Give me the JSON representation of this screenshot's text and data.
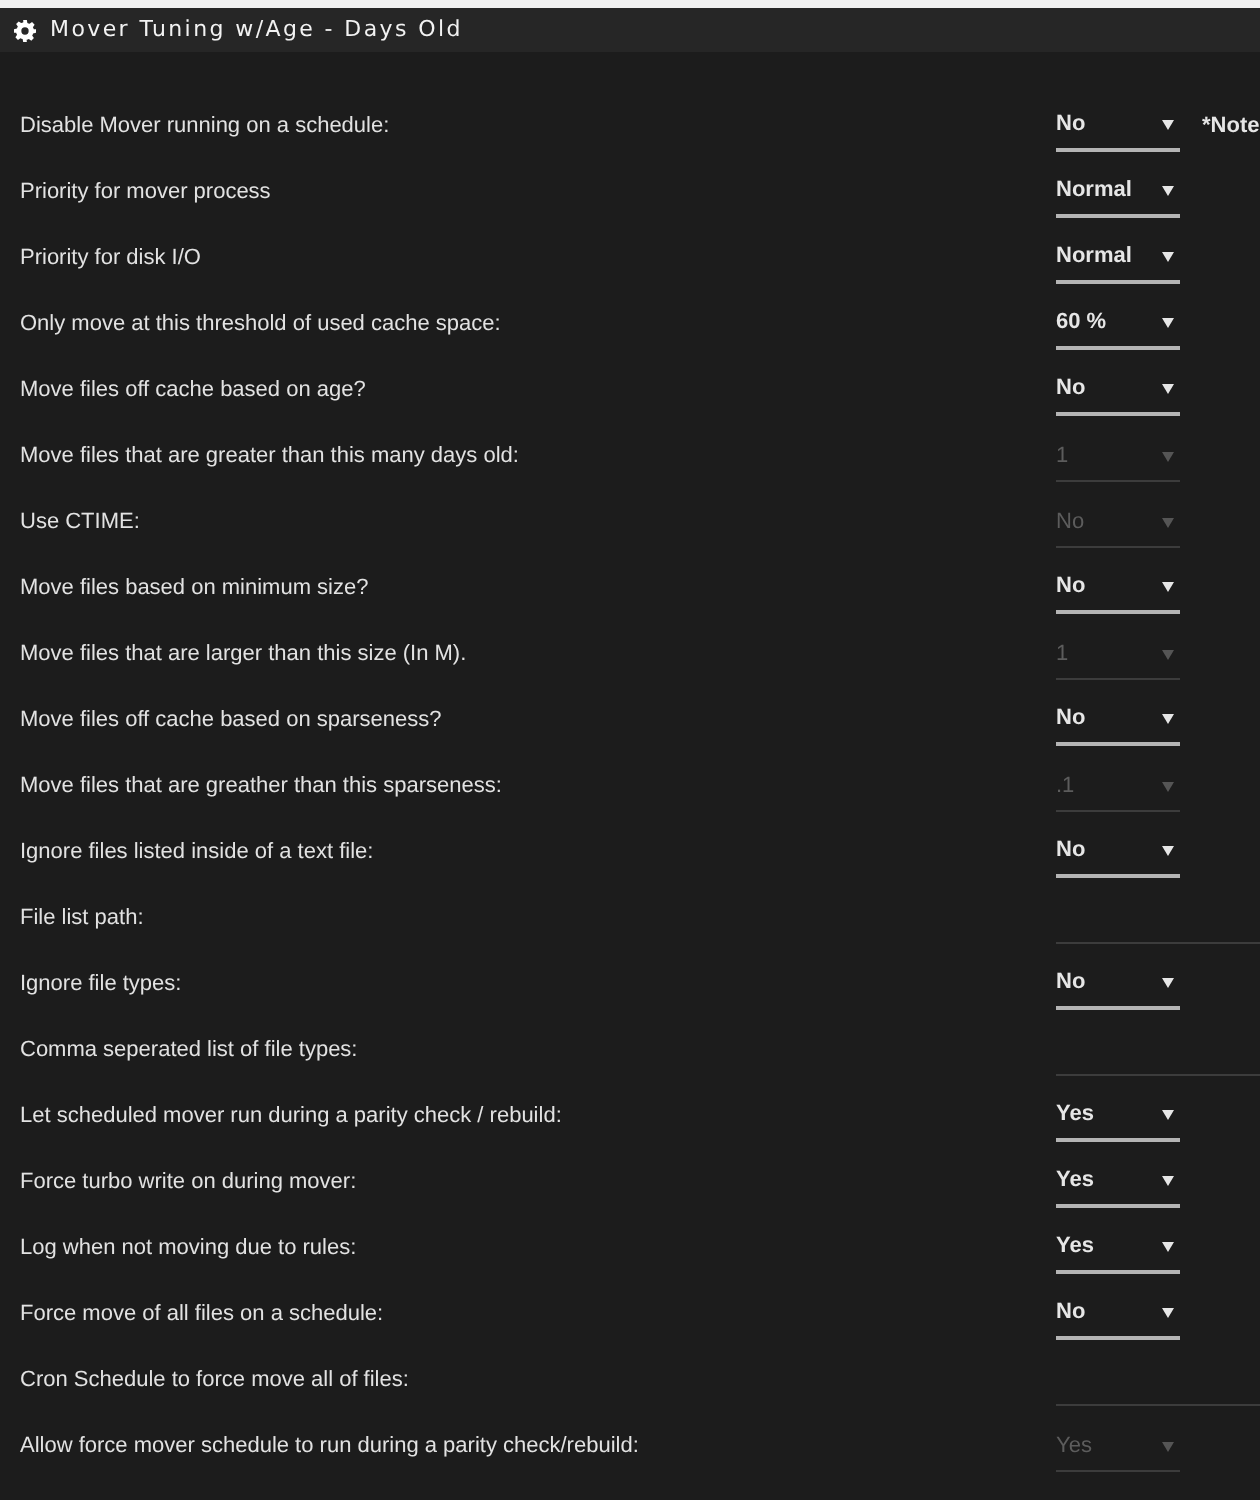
{
  "window": {
    "title": "Mover Tuning w/Age - Days Old"
  },
  "settings": [
    {
      "label": "Disable Mover running on a schedule:",
      "kind": "dropdown",
      "value": "No",
      "disabled": false,
      "note": "*Note"
    },
    {
      "label": "Priority for mover process",
      "kind": "dropdown",
      "value": "Normal",
      "disabled": false
    },
    {
      "label": "Priority for disk I/O",
      "kind": "dropdown",
      "value": "Normal",
      "disabled": false
    },
    {
      "label": "Only move at this threshold of used cache space:",
      "kind": "dropdown",
      "value": "60 %",
      "disabled": false
    },
    {
      "label": "Move files off cache based on age?",
      "kind": "dropdown",
      "value": "No",
      "disabled": false
    },
    {
      "label": "Move files that are greater than this many days old:",
      "kind": "dropdown",
      "value": "1",
      "disabled": true
    },
    {
      "label": "Use CTIME:",
      "kind": "dropdown",
      "value": "No",
      "disabled": true
    },
    {
      "label": "Move files based on minimum size?",
      "kind": "dropdown",
      "value": "No",
      "disabled": false
    },
    {
      "label": "Move files that are larger than this size (In M).",
      "kind": "dropdown",
      "value": "1",
      "disabled": true
    },
    {
      "label": "Move files off cache based on sparseness?",
      "kind": "dropdown",
      "value": "No",
      "disabled": false
    },
    {
      "label": "Move files that are greather than this sparseness:",
      "kind": "dropdown",
      "value": ".1",
      "disabled": true
    },
    {
      "label": "Ignore files listed inside of a text file:",
      "kind": "dropdown",
      "value": "No",
      "disabled": false
    },
    {
      "label": "File list path:",
      "kind": "text"
    },
    {
      "label": "Ignore file types:",
      "kind": "dropdown",
      "value": "No",
      "disabled": false
    },
    {
      "label": "Comma seperated list of file types:",
      "kind": "text"
    },
    {
      "label": "Let scheduled mover run during a parity check / rebuild:",
      "kind": "dropdown",
      "value": "Yes",
      "disabled": false
    },
    {
      "label": "Force turbo write on during mover:",
      "kind": "dropdown",
      "value": "Yes",
      "disabled": false
    },
    {
      "label": "Log when not moving due to rules:",
      "kind": "dropdown",
      "value": "Yes",
      "disabled": false
    },
    {
      "label": "Force move of all files on a schedule:",
      "kind": "dropdown",
      "value": "No",
      "disabled": false
    },
    {
      "label": "Cron Schedule to force move all of files:",
      "kind": "text"
    },
    {
      "label": "Allow force mover schedule to run during a parity check/rebuild:",
      "kind": "dropdown",
      "value": "Yes",
      "disabled": true
    }
  ]
}
